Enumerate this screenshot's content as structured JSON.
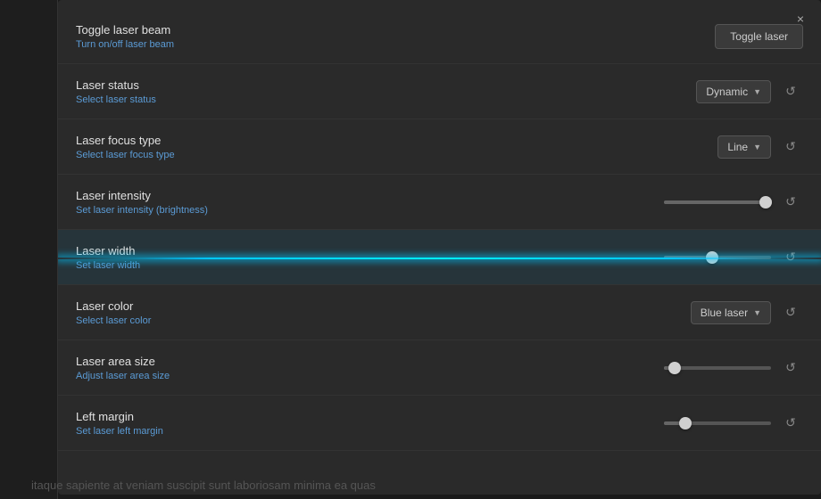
{
  "colors": {
    "accent": "#00c8ff",
    "bg_panel": "#2a2a2a",
    "bg_sidebar": "#1e1e1e",
    "bg_body": "#1a1a1a"
  },
  "close_button": "×",
  "bg_text": "itaque sapiente at veniam suscipit sunt laboriosam minima ea quas",
  "settings": [
    {
      "id": "toggle-laser-beam",
      "title": "Toggle laser beam",
      "desc": "Turn on/off laser beam",
      "control_type": "button",
      "button_label": "Toggle laser",
      "highlighted": false
    },
    {
      "id": "laser-status",
      "title": "Laser status",
      "desc": "Select laser status",
      "control_type": "dropdown",
      "dropdown_value": "Dynamic",
      "highlighted": false
    },
    {
      "id": "laser-focus-type",
      "title": "Laser focus type",
      "desc": "Select laser focus type",
      "control_type": "dropdown",
      "dropdown_value": "Line",
      "highlighted": false
    },
    {
      "id": "laser-intensity",
      "title": "Laser intensity",
      "desc": "Set laser intensity (brightness)",
      "control_type": "slider",
      "slider_percent": 95,
      "highlighted": false
    },
    {
      "id": "laser-width",
      "title": "Laser width",
      "desc": "Set laser width",
      "control_type": "slider",
      "slider_percent": 45,
      "highlighted": true
    },
    {
      "id": "laser-color",
      "title": "Laser color",
      "desc": "Select laser color",
      "control_type": "dropdown",
      "dropdown_value": "Blue laser",
      "highlighted": false
    },
    {
      "id": "laser-area-size",
      "title": "Laser area size",
      "desc": "Adjust laser area size",
      "control_type": "slider",
      "slider_percent": 10,
      "highlighted": false
    },
    {
      "id": "left-margin",
      "title": "Left margin",
      "desc": "Set laser left margin",
      "control_type": "slider",
      "slider_percent": 20,
      "highlighted": false
    }
  ]
}
